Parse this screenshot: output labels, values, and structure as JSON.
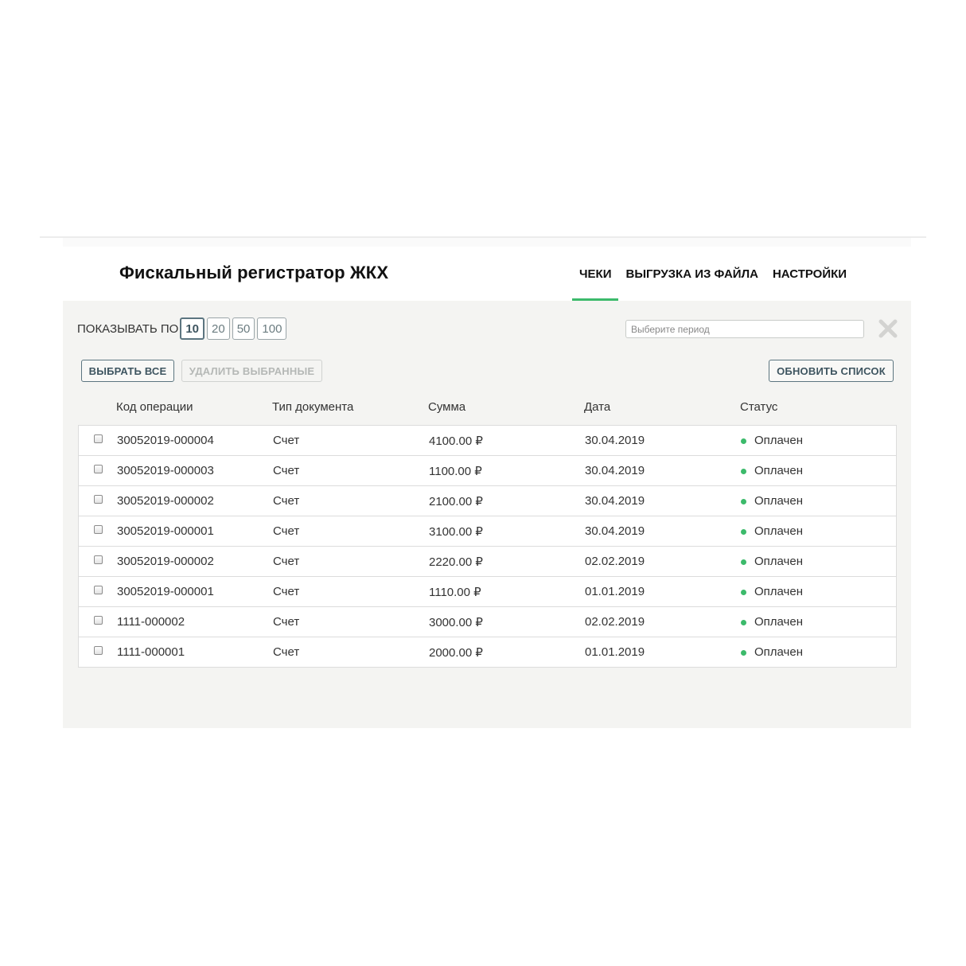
{
  "app": {
    "title": "Фискальный регистратор ЖКХ"
  },
  "nav": {
    "tabs": [
      {
        "label": "ЧЕКИ",
        "active": true
      },
      {
        "label": "ВЫГРУЗКА ИЗ ФАЙЛА",
        "active": false
      },
      {
        "label": "НАСТРОЙКИ",
        "active": false
      }
    ]
  },
  "toolbar": {
    "show_label": "ПОКАЗЫВАТЬ ПО",
    "page_sizes": [
      "10",
      "20",
      "50",
      "100"
    ],
    "selected_page_size": "10",
    "period_placeholder": "Выберите период",
    "period_value": "",
    "clear_icon": "close-icon",
    "select_all_label": "ВЫБРАТЬ ВСЕ",
    "delete_selected_label": "УДАЛИТЬ ВЫБРАННЫЕ",
    "refresh_label": "ОБНОВИТЬ СПИСОК"
  },
  "table": {
    "columns": [
      "Код операции",
      "Тип документа",
      "Сумма",
      "Дата",
      "Статус"
    ],
    "rows": [
      {
        "code": "30052019-000004",
        "type": "Счет",
        "sum": "4100.00 ₽",
        "date": "30.04.2019",
        "status": "Оплачен"
      },
      {
        "code": "30052019-000003",
        "type": "Счет",
        "sum": "1100.00 ₽",
        "date": "30.04.2019",
        "status": "Оплачен"
      },
      {
        "code": "30052019-000002",
        "type": "Счет",
        "sum": "2100.00 ₽",
        "date": "30.04.2019",
        "status": "Оплачен"
      },
      {
        "code": "30052019-000001",
        "type": "Счет",
        "sum": "3100.00 ₽",
        "date": "30.04.2019",
        "status": "Оплачен"
      },
      {
        "code": "30052019-000002",
        "type": "Счет",
        "sum": "2220.00 ₽",
        "date": "02.02.2019",
        "status": "Оплачен"
      },
      {
        "code": "30052019-000001",
        "type": "Счет",
        "sum": "1110.00 ₽",
        "date": "01.01.2019",
        "status": "Оплачен"
      },
      {
        "code": "1111-000002",
        "type": "Счет",
        "sum": "3000.00 ₽",
        "date": "02.02.2019",
        "status": "Оплачен"
      },
      {
        "code": "1111-000001",
        "type": "Счет",
        "sum": "2000.00 ₽",
        "date": "01.01.2019",
        "status": "Оплачен"
      }
    ]
  },
  "colors": {
    "accent": "#3cba6b",
    "panel_bg": "#f4f4f2",
    "button_border": "#5c7580",
    "status_paid": "#3cba6b"
  }
}
